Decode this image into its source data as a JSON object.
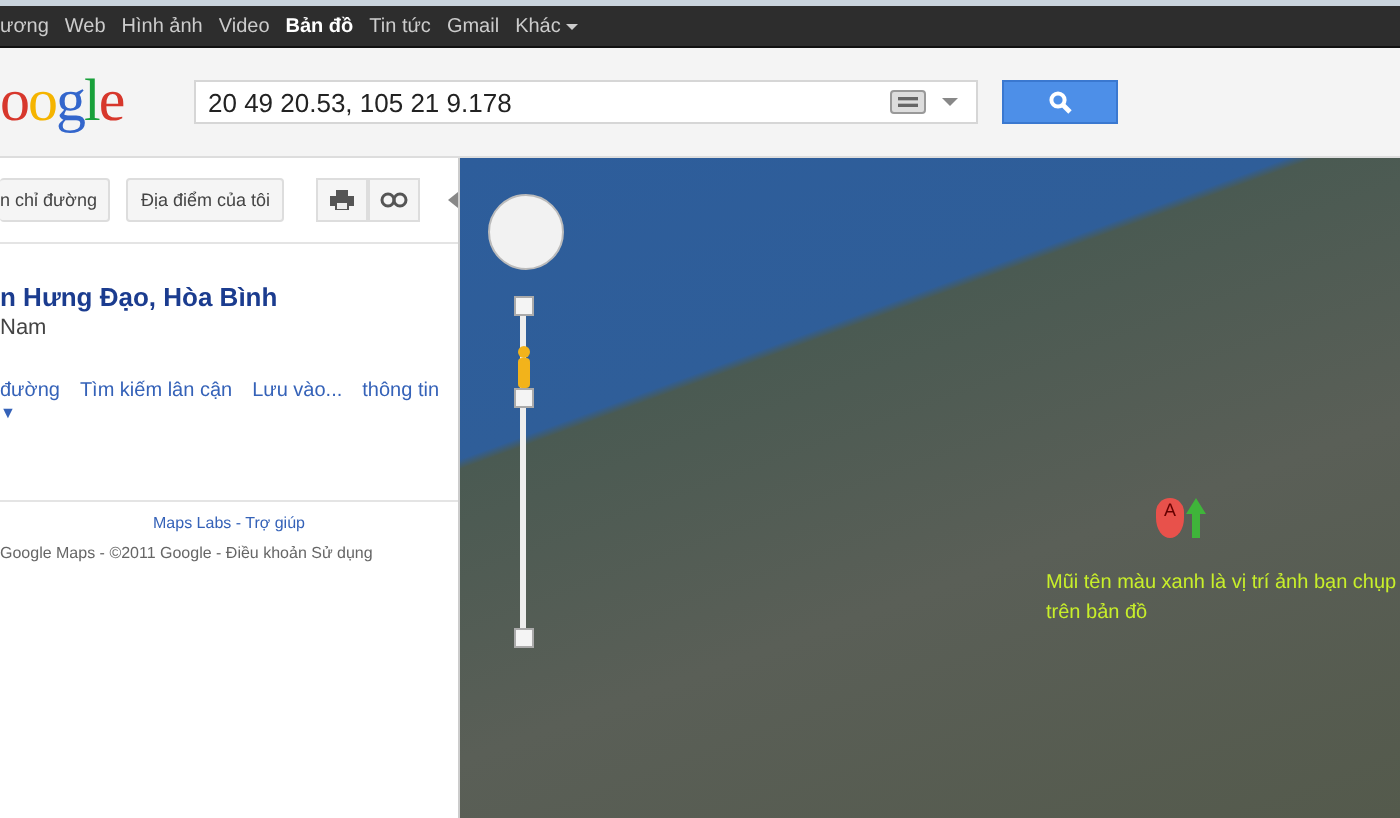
{
  "top_nav": [
    {
      "label": "ương",
      "selected": false
    },
    {
      "label": "Web",
      "selected": false
    },
    {
      "label": "Hình ảnh",
      "selected": false
    },
    {
      "label": "Video",
      "selected": false
    },
    {
      "label": "Bản đồ",
      "selected": true
    },
    {
      "label": "Tin tức",
      "selected": false
    },
    {
      "label": "Gmail",
      "selected": false
    },
    {
      "label": "Khác",
      "selected": false,
      "kind": "menu"
    }
  ],
  "logo": "oogle",
  "search": {
    "value": "20 49 20.53, 105 21 9.178"
  },
  "toolbar": {
    "buttons": [
      "n chỉ đường",
      "Địa điểm của tôi"
    ]
  },
  "place": {
    "title": "n Hưng Đạo, Hòa Bình",
    "subtitle": "Nam",
    "actions": [
      "đường",
      "Tìm kiếm lân cận",
      "Lưu vào...",
      "thông tin"
    ],
    "more": "▼"
  },
  "footer": {
    "links": [
      "Maps Labs - Trợ giúp"
    ],
    "copyright": "Google Maps - ©2011 Google - Điều khoản Sử dụng"
  },
  "map": {
    "marker": "A",
    "annotation": "Mũi tên màu xanh  là vị trí ảnh bạn chụp trên bản đồ"
  }
}
